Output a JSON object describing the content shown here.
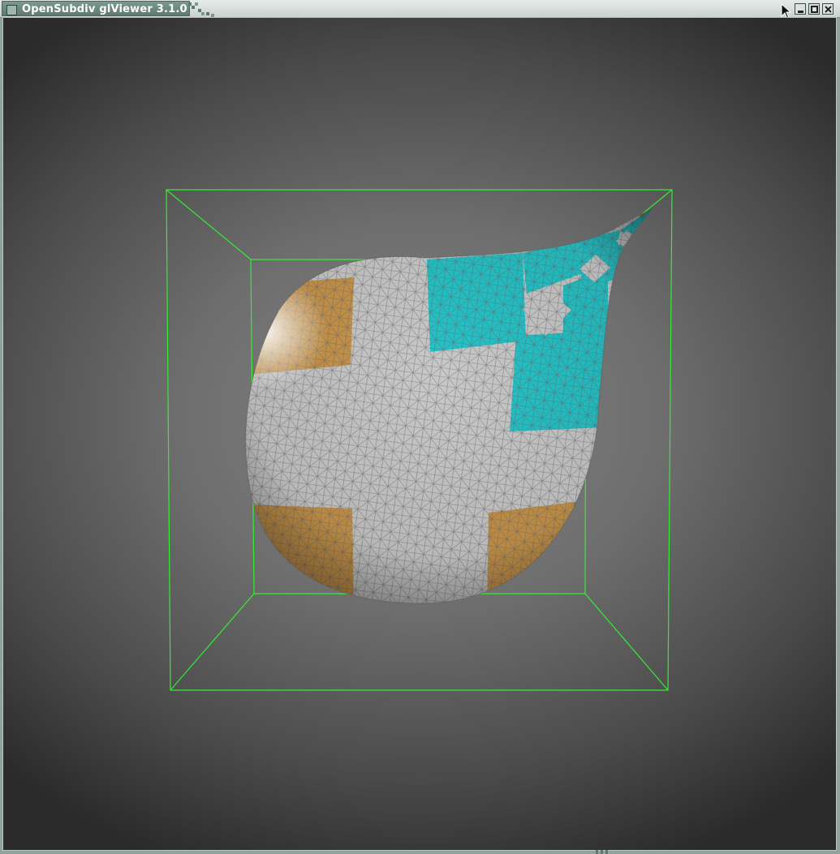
{
  "window": {
    "title": "OpenSubdiv glViewer 3.1.0",
    "icon": "app-window-icon",
    "buttons": [
      {
        "name": "minimize",
        "icon": "minimize-icon"
      },
      {
        "name": "maximize",
        "icon": "maximize-icon"
      },
      {
        "name": "close",
        "icon": "close-icon"
      }
    ]
  },
  "viewport": {
    "background_colors": [
      "#838383",
      "#2b2b2b"
    ],
    "bounding_box_color": "#33ee33",
    "model": {
      "name": "subdivided-teardrop-mesh",
      "base_color": "#c8c8c8",
      "patch_colors": {
        "orange": "#c8944a",
        "cyan": "#24c3c8"
      }
    }
  }
}
